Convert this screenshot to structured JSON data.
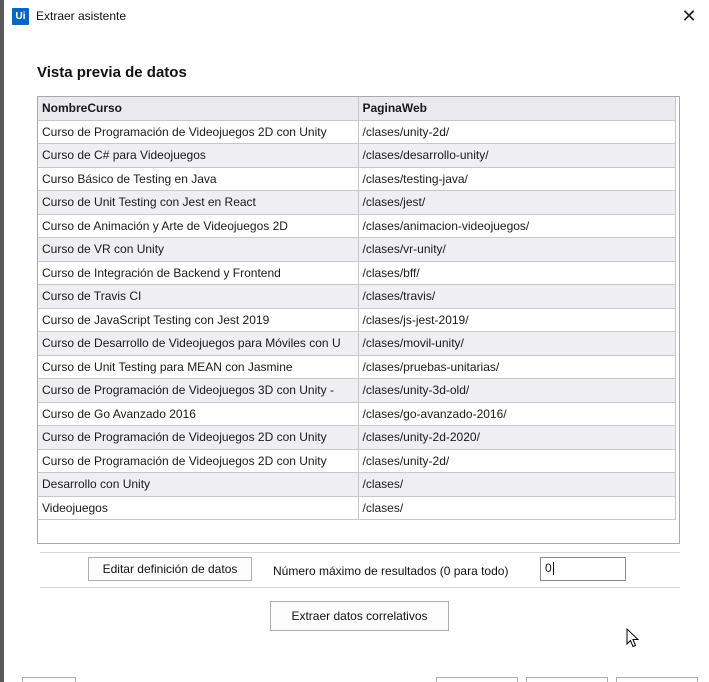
{
  "window": {
    "title": "Extraer asistente",
    "app_icon_text": "Ui",
    "close_glyph": "✕"
  },
  "heading": "Vista previa de datos",
  "table": {
    "columns": [
      "NombreCurso",
      "PaginaWeb"
    ],
    "rows": [
      [
        "Curso de Programación de Videojuegos 2D con Unity",
        "/clases/unity-2d/"
      ],
      [
        "Curso de C# para Videojuegos",
        "/clases/desarrollo-unity/"
      ],
      [
        "Curso Básico de Testing en Java",
        "/clases/testing-java/"
      ],
      [
        "Curso de Unit Testing con Jest en React",
        "/clases/jest/"
      ],
      [
        "Curso de Animación y Arte de Videojuegos 2D",
        "/clases/animacion-videojuegos/"
      ],
      [
        "Curso de VR con Unity",
        "/clases/vr-unity/"
      ],
      [
        "Curso de Integración de Backend y Frontend",
        "/clases/bff/"
      ],
      [
        "Curso de Travis CI",
        "/clases/travis/"
      ],
      [
        "Curso de JavaScript Testing con Jest 2019",
        "/clases/js-jest-2019/"
      ],
      [
        "Curso de Desarrollo de Videojuegos para Móviles con U",
        "/clases/movil-unity/"
      ],
      [
        "Curso de Unit Testing para MEAN con Jasmine",
        "/clases/pruebas-unitarias/"
      ],
      [
        "Curso de Programación de Videojuegos 3D con Unity - ",
        "/clases/unity-3d-old/"
      ],
      [
        "Curso de Go Avanzado 2016",
        "/clases/go-avanzado-2016/"
      ],
      [
        "Curso de Programación de Videojuegos 2D con Unity",
        "/clases/unity-2d-2020/"
      ],
      [
        "Curso de Programación de Videojuegos 2D con Unity",
        "/clases/unity-2d/"
      ],
      [
        "Desarrollo con Unity",
        "/clases/"
      ],
      [
        "Videojuegos",
        "/clases/"
      ]
    ]
  },
  "controls": {
    "edit_button": "Editar definición de datos",
    "max_results_label": "Número máximo de resultados (0 para todo)",
    "max_results_value": "0",
    "extract_button": "Extraer datos correlativos"
  },
  "icons": {
    "cursor": "mouse-pointer-icon"
  },
  "colors": {
    "app_icon": "#0a66c2",
    "header_bg": "#e9e9ee",
    "alt_row_bg": "#eeeef3"
  }
}
